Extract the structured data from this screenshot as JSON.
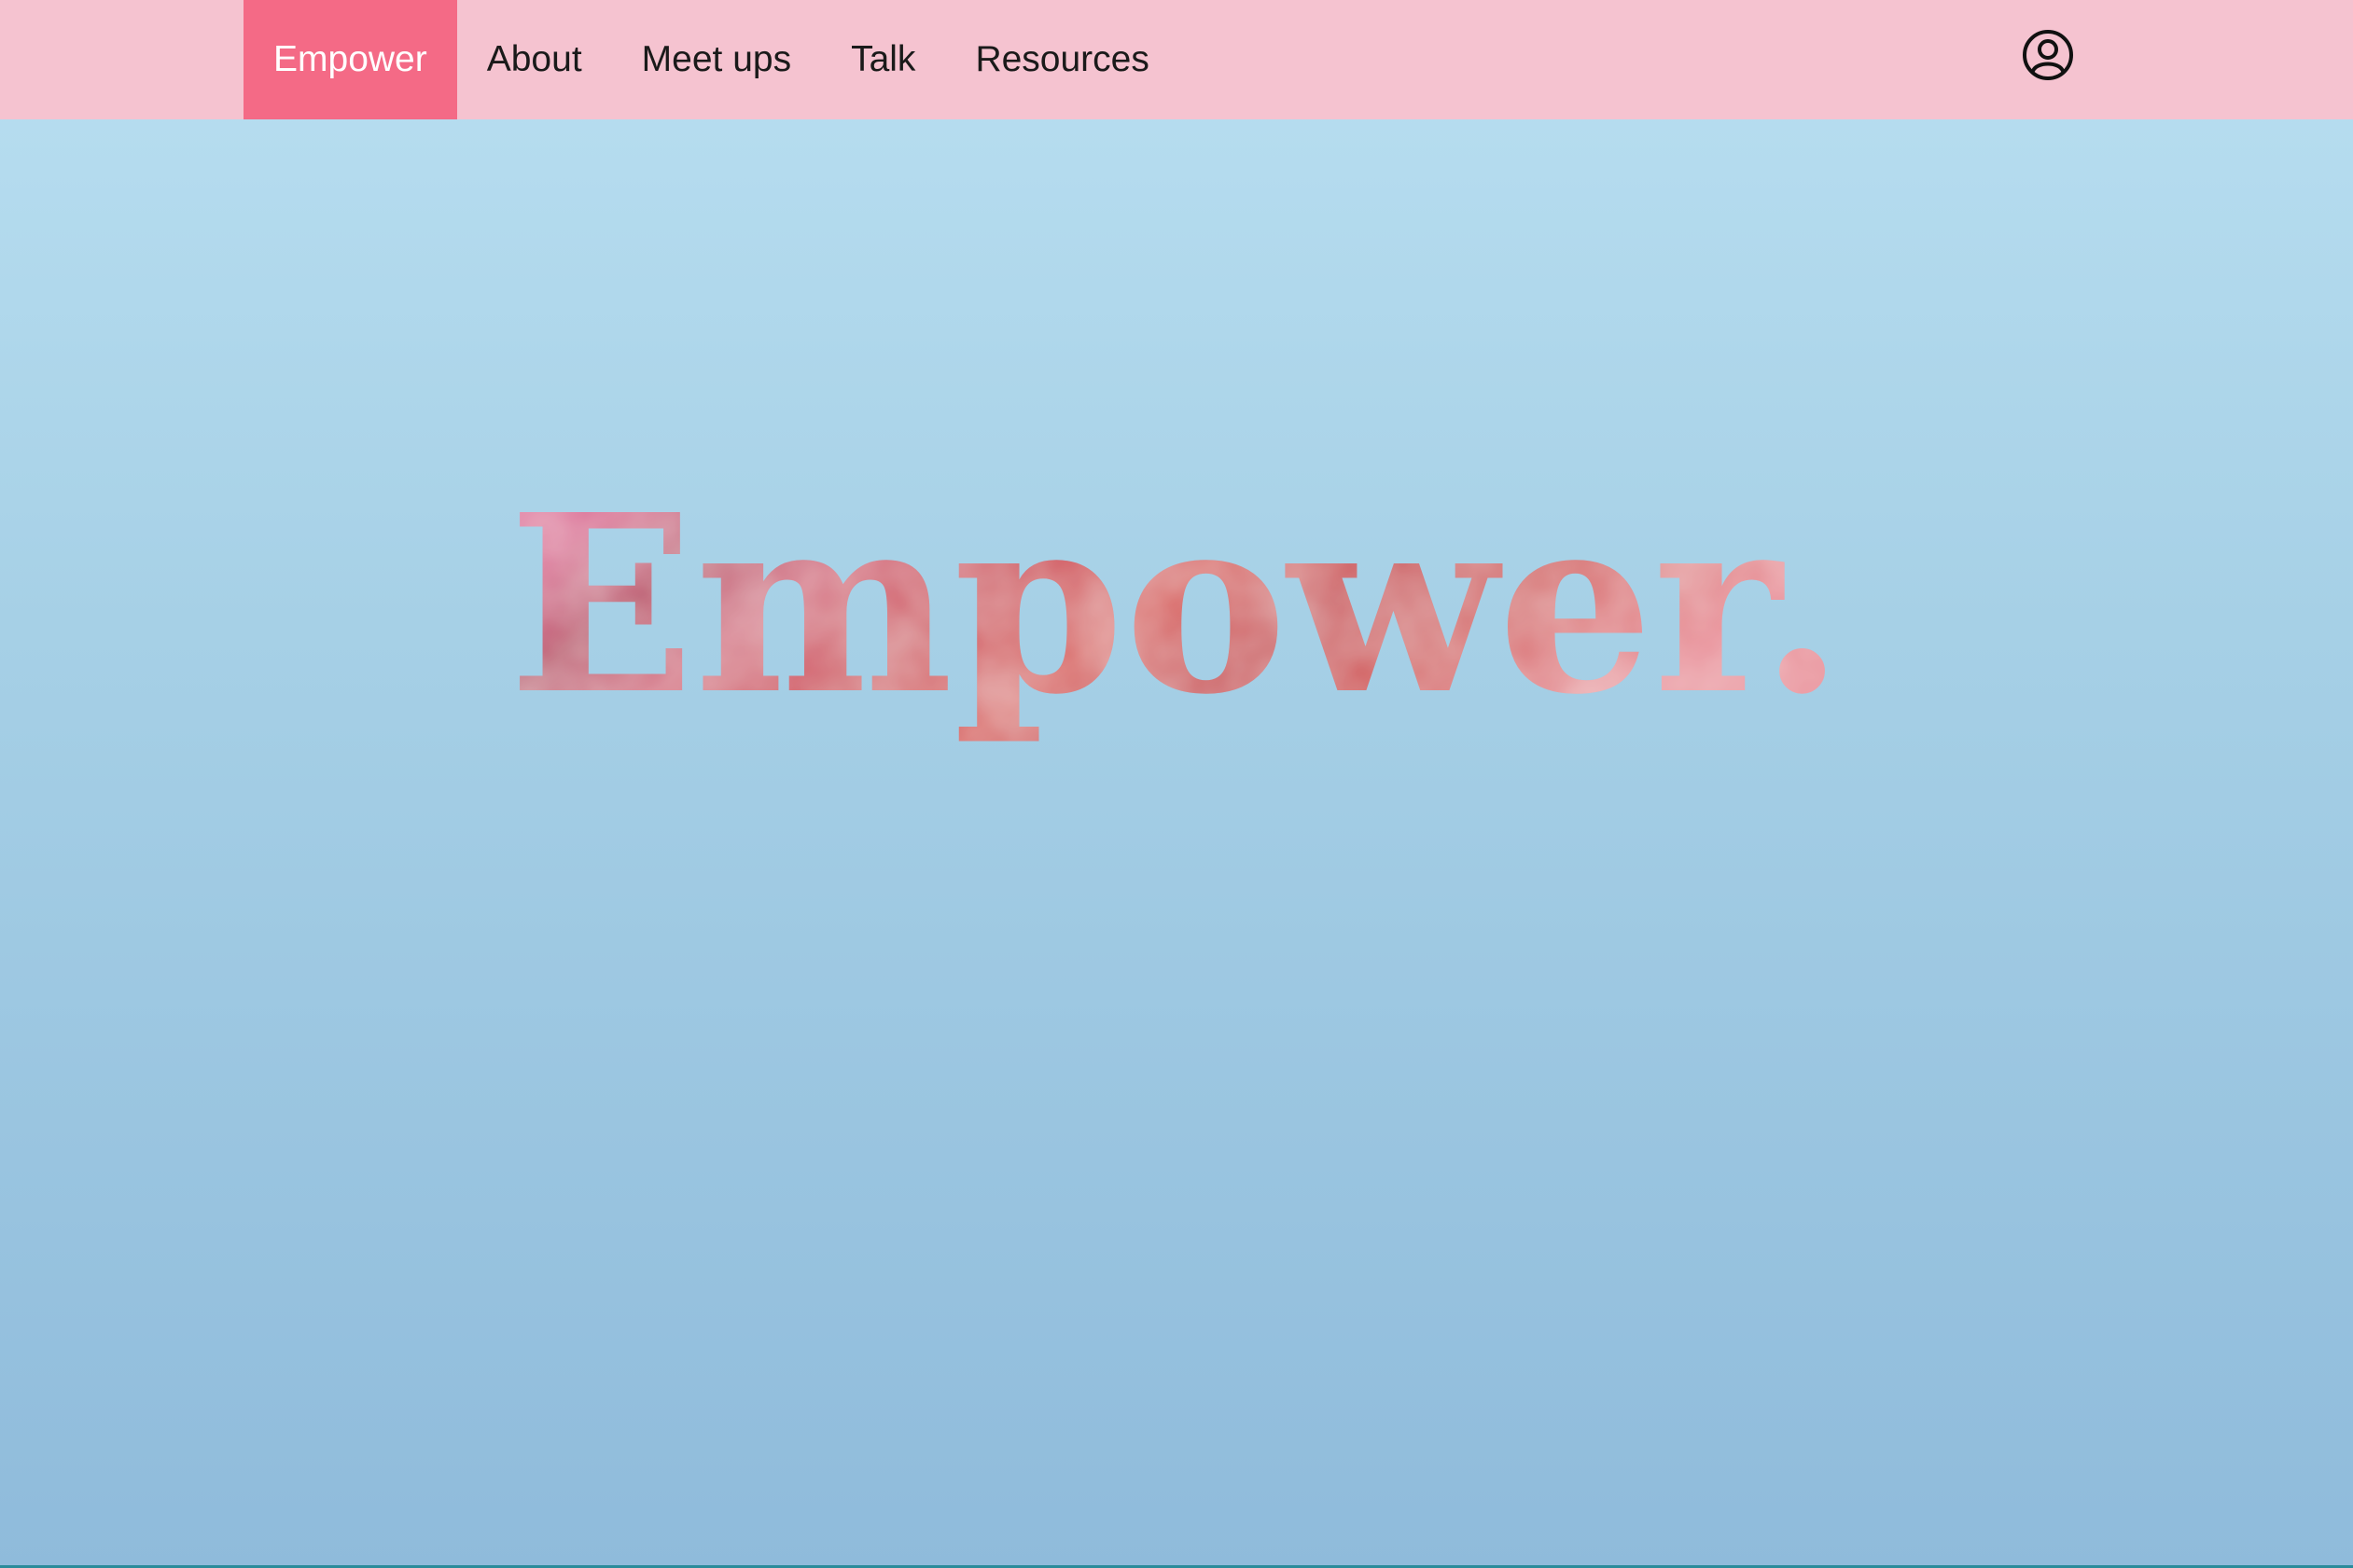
{
  "nav": {
    "items": [
      {
        "label": "Empower",
        "active": true
      },
      {
        "label": "About",
        "active": false
      },
      {
        "label": "Meet ups",
        "active": false
      },
      {
        "label": "Talk",
        "active": false
      },
      {
        "label": "Resources",
        "active": false
      }
    ],
    "user_icon": "user-circle-icon"
  },
  "hero": {
    "title": "Empower."
  },
  "colors": {
    "nav_bg": "#f5c3d0",
    "nav_active": "#f46a86",
    "title_gradient": [
      "#e070a0",
      "#c9344f",
      "#d65a5a",
      "#e08080"
    ]
  }
}
